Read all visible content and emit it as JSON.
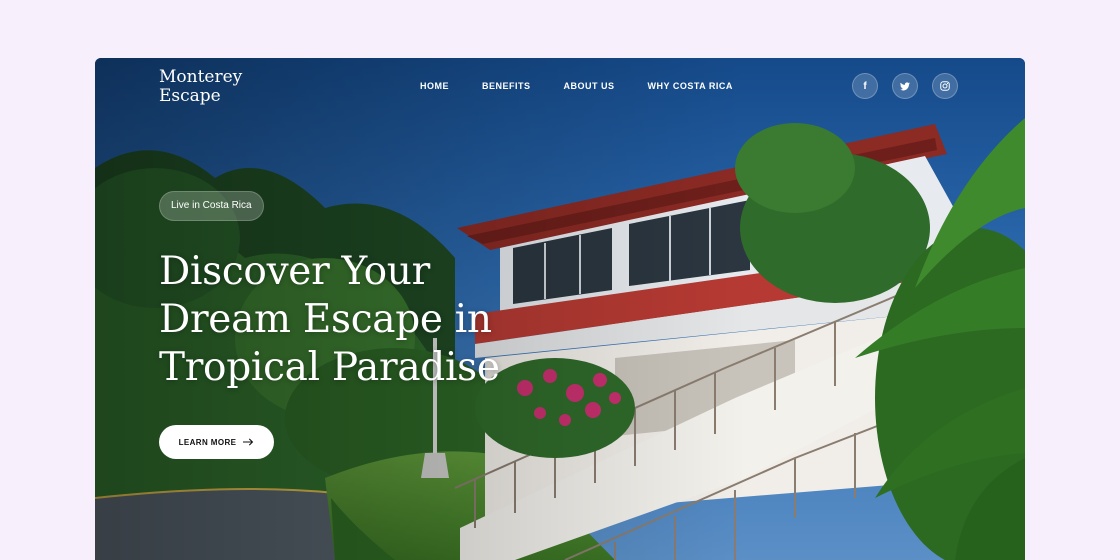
{
  "brand": {
    "line1": "Monterey",
    "line2": "Escape"
  },
  "nav": [
    {
      "label": "HOME"
    },
    {
      "label": "BENEFITS"
    },
    {
      "label": "ABOUT US"
    },
    {
      "label": "WHY COSTA RICA"
    }
  ],
  "socials": [
    {
      "icon": "facebook-icon",
      "glyph": "f"
    },
    {
      "icon": "twitter-icon"
    },
    {
      "icon": "instagram-icon"
    }
  ],
  "hero": {
    "badge": "Live in Costa Rica",
    "headline": [
      "Discover Your",
      "Dream Escape in",
      "Tropical Paradise"
    ],
    "cta_label": "LEARN MORE",
    "cta_icon": "arrow-right-icon"
  },
  "colors": {
    "page_background": "#f8effc",
    "sky": "#1c4f8c",
    "roof": "#8c2a24",
    "button_bg": "#ffffff"
  }
}
